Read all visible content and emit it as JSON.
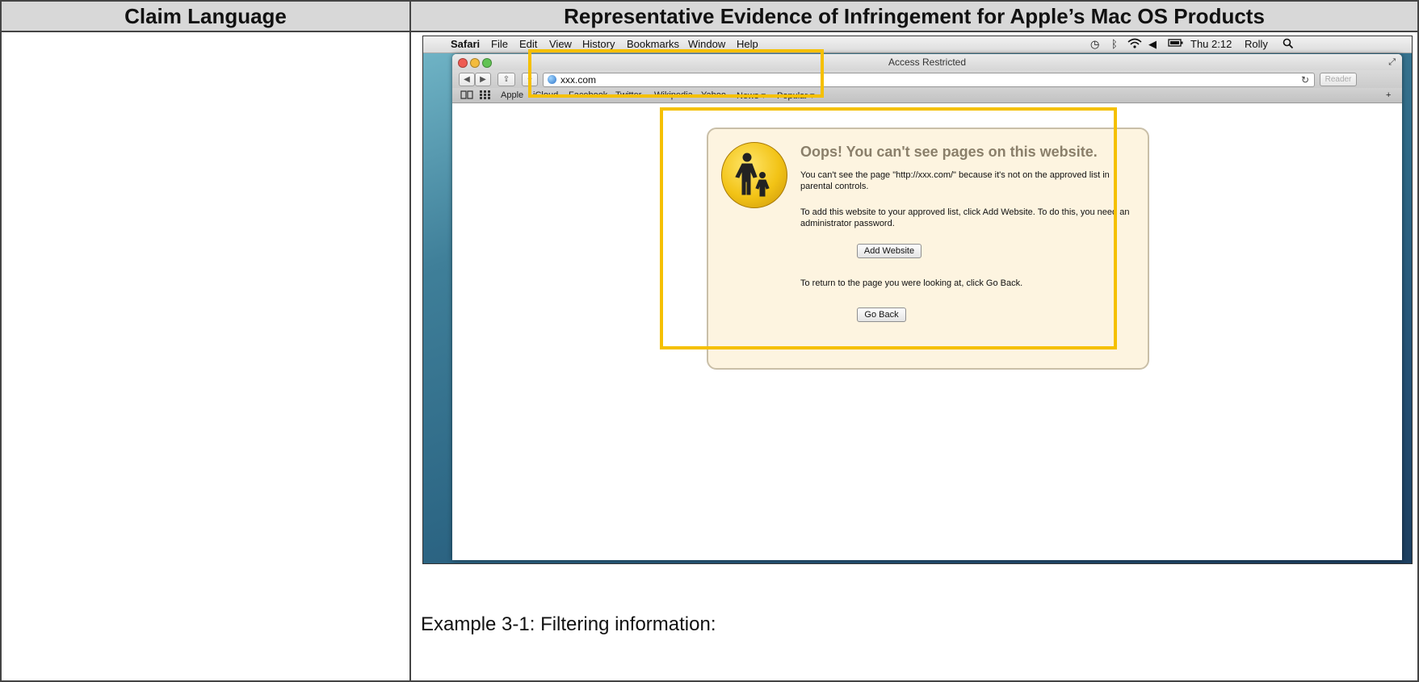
{
  "table": {
    "header_left": "Claim Language",
    "header_right": "Representative Evidence of Infringement for Apple’s Mac OS Products"
  },
  "menubar": {
    "app_name": "Safari",
    "items": [
      "File",
      "Edit",
      "View",
      "History",
      "Bookmarks",
      "Window",
      "Help"
    ],
    "clock": "Thu 2:12",
    "user": "Rolly"
  },
  "window": {
    "title": "Access Restricted",
    "address": "xxx.com",
    "reader_label": "Reader",
    "bookmarks": [
      "Apple",
      "iCloud",
      "Facebook",
      "Twitter",
      "Wikipedia",
      "Yahoo",
      "News ▾",
      "Popular ▾"
    ]
  },
  "panel": {
    "title": "Oops! You can't see pages on this website.",
    "line1": "You can't see the page \"http://xxx.com/\" because it's not on the approved list in parental controls.",
    "line2": "To add this website to your approved list, click Add Website. To do this, you need an administrator password.",
    "add_button": "Add Website",
    "line3": "To return to the page you were looking at, click Go Back.",
    "back_button": "Go Back"
  },
  "caption": "Example 3-1: Filtering information:",
  "colors": {
    "highlight": "#f5c000",
    "header_bg": "#d8d8d8",
    "panel_bg": "#fdf4e0"
  },
  "icons": [
    "apple-logo-icon",
    "time-machine-icon",
    "bluetooth-icon",
    "wifi-icon",
    "volume-icon",
    "battery-icon",
    "spotlight-icon",
    "parental-controls-icon"
  ]
}
